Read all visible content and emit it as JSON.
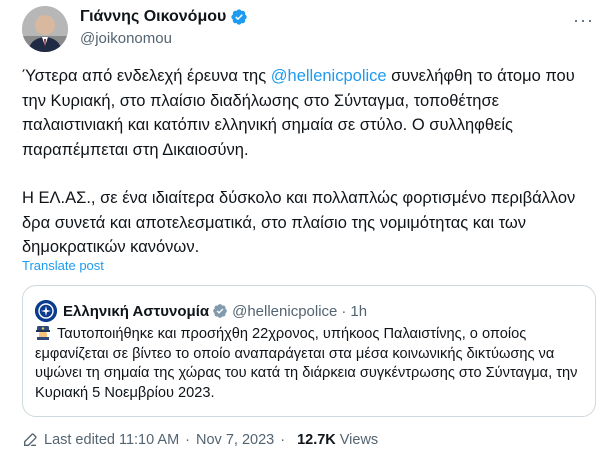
{
  "author": {
    "name": "Γιάννης Οικονόμου",
    "handle": "@joikonomou"
  },
  "more_label": "···",
  "body": {
    "p1_before": "Ύστερα από ενδελεχή έρευνα της ",
    "p1_mention": "@hellenicpolice",
    "p1_after": " συνελήφθη το άτομο που την Κυριακή, στο πλαίσιο διαδήλωσης στο Σύνταγμα, τοποθέτησε παλαιστινιακή και κατόπιν ελληνική σημαία σε στύλο. Ο συλληφθείς παραπέμπεται στη Δικαιοσύνη.",
    "p2": "Η ΕΛ.ΑΣ., σε ένα ιδιαίτερα δύσκολο και πολλαπλώς φορτισμένο περιβάλλον  δρα συνετά και αποτελεσματικά, στο πλαίσιο της νομιμότητας και των δημοκρατικών κανόνων."
  },
  "translate_label": "Translate post",
  "quote": {
    "name": "Ελληνική Αστυνομία",
    "handle": "@hellenicpolice",
    "separator": "·",
    "time": "1h",
    "text": "Ταυτοποιήθηκε και προσήχθη 22χρονος, υπήκοος Παλαιστίνης, ο οποίος εμφανίζεται σε βίντεο το οποίο αναπαράγεται στα μέσα κοινωνικής δικτύωσης να υψώνει τη σημαία της χώρας του κατά τη διάρκεια συγκέντρωσης στο Σύνταγμα, την Κυριακή 5 Νοεμβρίου 2023."
  },
  "meta": {
    "edited": "Last edited 11:10 AM",
    "dot1": "·",
    "date": "Nov 7, 2023",
    "dot2": "·",
    "views_count": "12.7K",
    "views_label": "Views"
  },
  "colors": {
    "accent": "#1d9bf0",
    "text": "#0f1419",
    "muted": "#536471",
    "border": "#cfd9de"
  }
}
